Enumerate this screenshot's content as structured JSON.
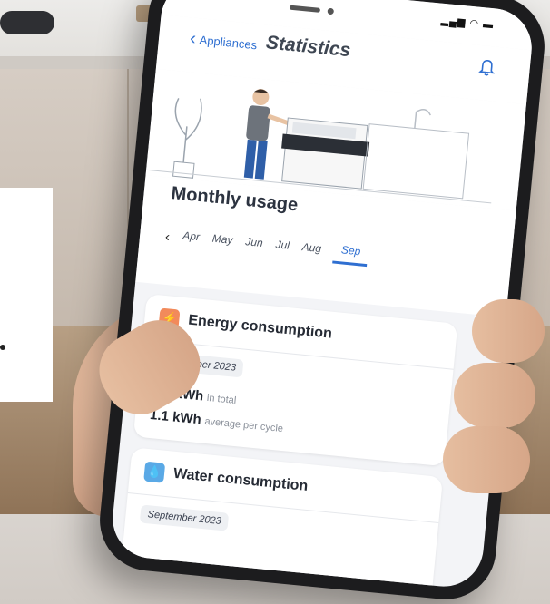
{
  "header": {
    "back_label": "Appliances",
    "title": "Statistics"
  },
  "usage": {
    "title": "Monthly usage",
    "months": [
      "Apr",
      "May",
      "Jun",
      "Jul",
      "Aug",
      "Sep"
    ],
    "selected_month": "Sep"
  },
  "energy_card": {
    "title": "Energy consumption",
    "date": "September 2023",
    "total_value": "3.2 kWh",
    "total_label": "in total",
    "avg_value": "1.1 kWh",
    "avg_label": "average per cycle"
  },
  "water_card": {
    "title": "Water consumption",
    "date": "September 2023"
  },
  "colors": {
    "accent": "#2f6fd1",
    "energy_icon": "#f28a5b",
    "water_icon": "#5aa9e6"
  },
  "icons": {
    "back": "chevron-left-icon",
    "bell": "bell-icon",
    "prev_month": "chevron-left-icon",
    "energy": "lightning-icon",
    "water": "droplet-icon"
  }
}
